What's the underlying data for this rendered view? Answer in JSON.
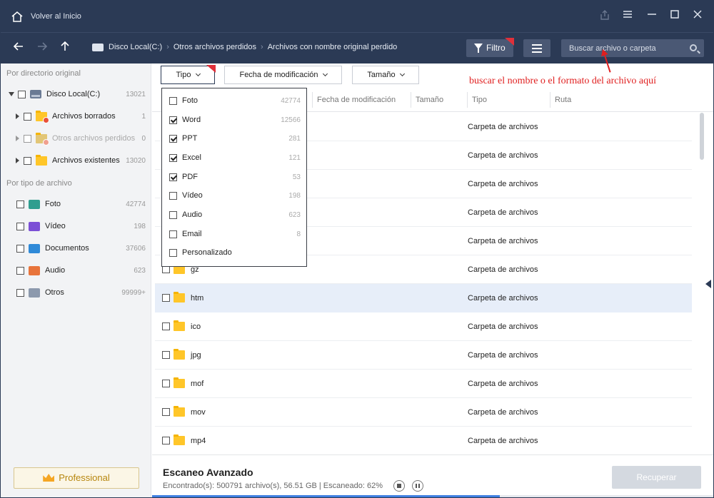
{
  "titlebar": {
    "title": "Volver al Inicio"
  },
  "navbar": {
    "breadcrumbs": [
      "Disco Local(C:)",
      "Otros archivos perdidos",
      "Archivos con nombre original perdido"
    ],
    "filter_label": "Filtro",
    "search_placeholder": "Buscar archivo o carpeta"
  },
  "sidebar": {
    "dir_heading": "Por directorio original",
    "root": {
      "label": "Disco Local(C:)",
      "count": "13021"
    },
    "children": [
      {
        "label": "Archivos borrados",
        "count": "1"
      },
      {
        "label": "Otros archivos perdidos",
        "count": "0"
      },
      {
        "label": "Archivos existentes",
        "count": "13020"
      }
    ],
    "type_heading": "Por tipo de archivo",
    "types": [
      {
        "label": "Foto",
        "count": "42774",
        "color": "#2f9e8f"
      },
      {
        "label": "Vídeo",
        "count": "198",
        "color": "#7b4fd6"
      },
      {
        "label": "Documentos",
        "count": "37606",
        "color": "#2f8ad8"
      },
      {
        "label": "Audio",
        "count": "623",
        "color": "#e8743b"
      },
      {
        "label": "Otros",
        "count": "99999+",
        "color": "#8c99ad"
      }
    ],
    "pro_label": "Professional"
  },
  "filters": {
    "tipo": "Tipo",
    "fecha": "Fecha de modificación",
    "tamano": "Tamaño"
  },
  "hint": "buscar el nombre o el formato del archivo aquí",
  "columns": {
    "fecha": "Fecha de modificación",
    "tamano": "Tamaño",
    "tipo": "Tipo",
    "ruta": "Ruta"
  },
  "dropdown": [
    {
      "label": "Foto",
      "count": "42774",
      "checked": false
    },
    {
      "label": "Word",
      "count": "12566",
      "checked": true
    },
    {
      "label": "PPT",
      "count": "281",
      "checked": true
    },
    {
      "label": "Excel",
      "count": "121",
      "checked": true
    },
    {
      "label": "PDF",
      "count": "53",
      "checked": true
    },
    {
      "label": "Vídeo",
      "count": "198",
      "checked": false
    },
    {
      "label": "Audio",
      "count": "623",
      "checked": false
    },
    {
      "label": "Email",
      "count": "8",
      "checked": false
    },
    {
      "label": "Personalizado",
      "count": "",
      "checked": false
    }
  ],
  "rows": [
    {
      "name": "",
      "tipo": "Carpeta de archivos"
    },
    {
      "name": "",
      "tipo": "Carpeta de archivos"
    },
    {
      "name": "",
      "tipo": "Carpeta de archivos"
    },
    {
      "name": "",
      "tipo": "Carpeta de archivos"
    },
    {
      "name": "",
      "tipo": "Carpeta de archivos"
    },
    {
      "name": "gz",
      "tipo": "Carpeta de archivos"
    },
    {
      "name": "htm",
      "tipo": "Carpeta de archivos"
    },
    {
      "name": "ico",
      "tipo": "Carpeta de archivos"
    },
    {
      "name": "jpg",
      "tipo": "Carpeta de archivos"
    },
    {
      "name": "mof",
      "tipo": "Carpeta de archivos"
    },
    {
      "name": "mov",
      "tipo": "Carpeta de archivos"
    },
    {
      "name": "mp4",
      "tipo": "Carpeta de archivos"
    }
  ],
  "footer": {
    "title": "Escaneo Avanzado",
    "status": "Encontrado(s): 500791 archivo(s), 56.51 GB | Escaneado: 62%",
    "progress": 0.62,
    "recover": "Recuperar"
  }
}
